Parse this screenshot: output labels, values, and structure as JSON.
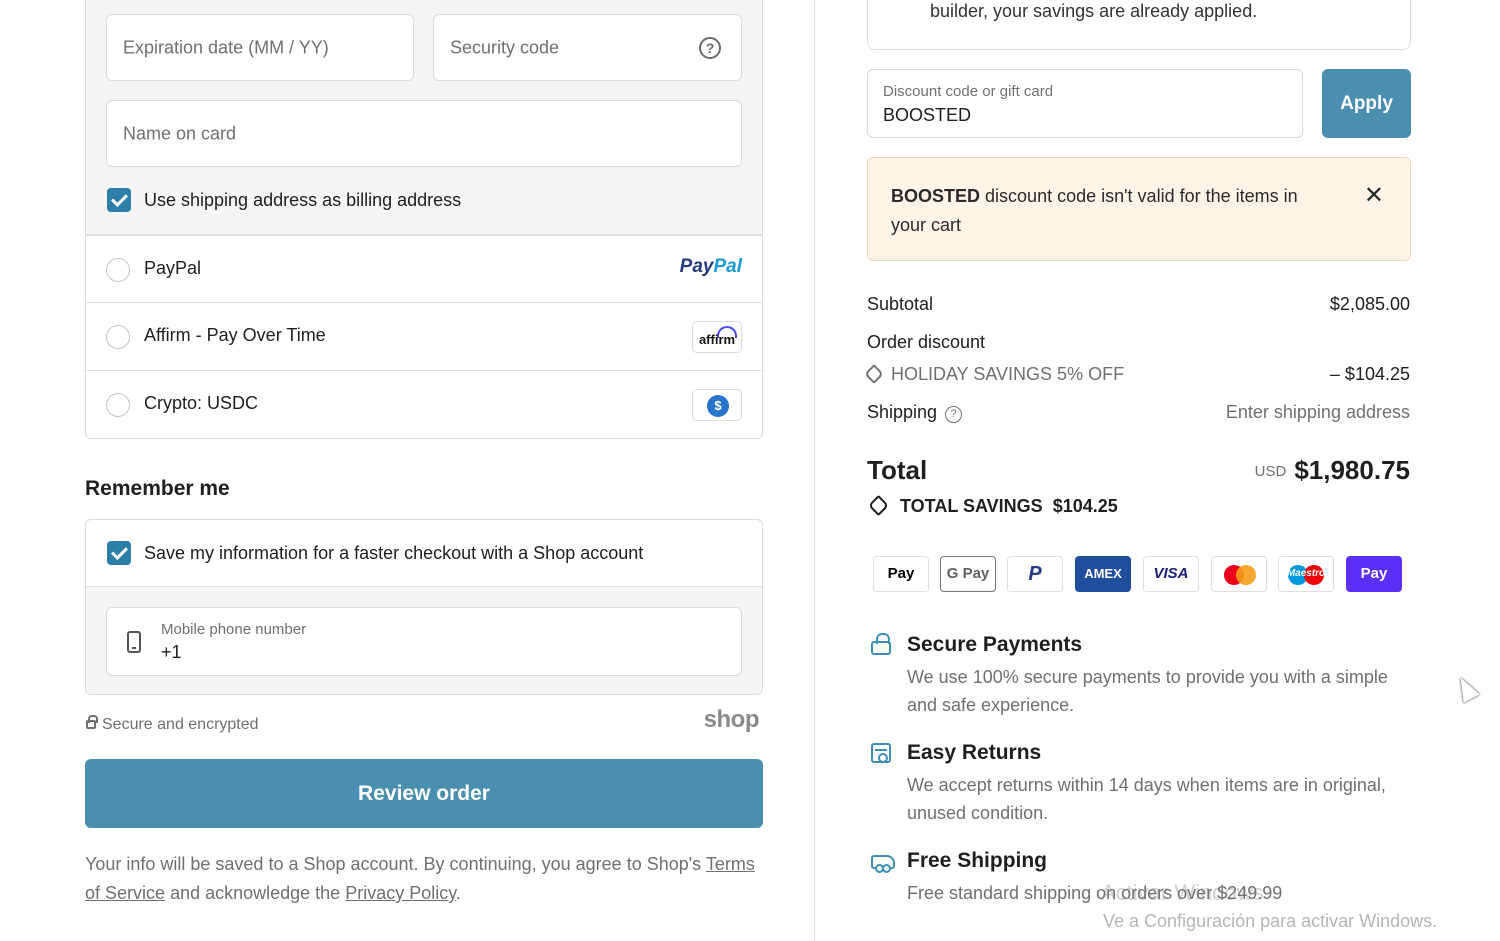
{
  "payment": {
    "expiration_placeholder": "Expiration date (MM / YY)",
    "security_placeholder": "Security code",
    "security_help_icon": "?",
    "name_placeholder": "Name on card",
    "billing_checkbox_label": "Use shipping address as billing address",
    "billing_checked": true,
    "methods": [
      {
        "label": "PayPal",
        "logo_part1": "Pay",
        "logo_part2": "Pal"
      },
      {
        "label": "Affirm - Pay Over Time",
        "logo": "affirm"
      },
      {
        "label": "Crypto: USDC",
        "logo": "usdc-icon"
      }
    ]
  },
  "remember": {
    "title": "Remember me",
    "save_label": "Save my information for a faster checkout with a Shop account",
    "save_checked": true,
    "phone_label": "Mobile phone number",
    "phone_value": "+1"
  },
  "footer": {
    "secure_text": "Secure and encrypted",
    "shop_logo": "shop",
    "review_button": "Review order",
    "legal_prefix": "Your info will be saved to a Shop account. By continuing, you agree to Shop's",
    "terms_link": "Terms of Service",
    "legal_middle": "and acknowledge the",
    "privacy_link": "Privacy Policy",
    "legal_suffix": "."
  },
  "summary": {
    "info_text": "builder, your savings are already applied.",
    "discount_label": "Discount code or gift card",
    "discount_value": "BOOSTED",
    "apply_button": "Apply",
    "error_code": "BOOSTED",
    "error_message": "discount code isn't valid for the items in your cart",
    "close_symbol": "✕",
    "subtotal_label": "Subtotal",
    "subtotal_value": "$2,085.00",
    "order_discount_label": "Order discount",
    "discount_name": "HOLIDAY SAVINGS 5% OFF",
    "discount_amount": "– $104.25",
    "shipping_label": "Shipping",
    "shipping_help_icon": "?",
    "shipping_value": "Enter shipping address",
    "total_label": "Total",
    "total_currency": "USD",
    "total_value": "$1,980.75",
    "savings_label": "TOTAL SAVINGS",
    "savings_value": "$104.25"
  },
  "payment_icons": [
    {
      "name": "apple-pay-icon",
      "text": "Pay",
      "symbol": ""
    },
    {
      "name": "google-pay-icon",
      "text": "G Pay"
    },
    {
      "name": "paypal-icon",
      "text": "P"
    },
    {
      "name": "amex-icon",
      "text": "AMEX"
    },
    {
      "name": "visa-icon",
      "text": "VISA"
    },
    {
      "name": "mastercard-icon",
      "text": ""
    },
    {
      "name": "maestro-icon",
      "text": "Maestro"
    },
    {
      "name": "shop-pay-icon",
      "text": "Pay"
    }
  ],
  "features": [
    {
      "title": "Secure Payments",
      "description": "We use 100% secure payments to provide you with a simple and safe experience."
    },
    {
      "title": "Easy Returns",
      "description": "We accept returns within 14 days when items are in original, unused condition."
    },
    {
      "title": "Free Shipping",
      "description": "Free standard shipping on orders over $249.99"
    }
  ],
  "watermark": {
    "line1": "Activar Windows",
    "line2": "Ve a Configuración para activar Windows."
  },
  "colors": {
    "accent": "#4a8fb0",
    "error_bg": "#fff4e8",
    "checkbox": "#2e7fa8"
  }
}
